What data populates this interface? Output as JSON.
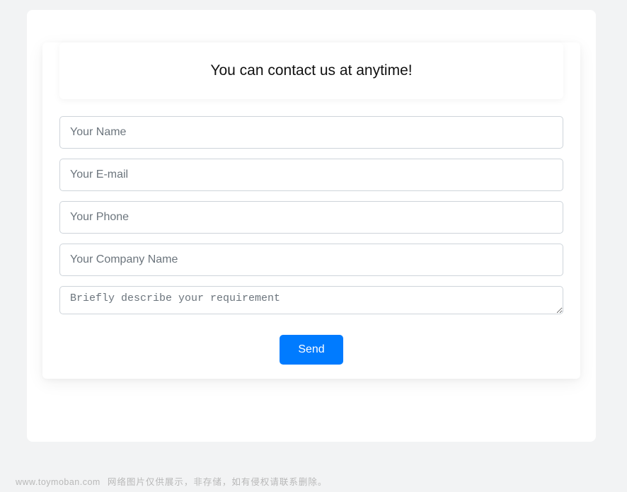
{
  "header": {
    "title": "You can contact us at anytime!"
  },
  "form": {
    "name_placeholder": "Your Name",
    "email_placeholder": "Your E-mail",
    "phone_placeholder": "Your Phone",
    "company_placeholder": "Your Company Name",
    "message_placeholder": "Briefly describe your requirement",
    "submit_label": "Send"
  },
  "footer": {
    "domain": "www.toymoban.com",
    "notice": "网络图片仅供展示，非存储，如有侵权请联系删除。"
  }
}
